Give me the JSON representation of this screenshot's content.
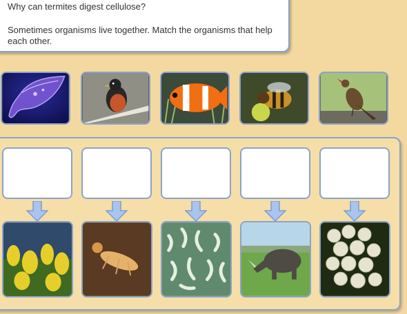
{
  "question": {
    "line1": "Why can termites digest cellulose?",
    "line2": "Sometimes organisms live together. Match the organisms that help each other."
  },
  "cards": [
    {
      "name": "protozoan",
      "icon": "protozoan-image"
    },
    {
      "name": "robin",
      "icon": "robin-image"
    },
    {
      "name": "clownfish",
      "icon": "clownfish-image"
    },
    {
      "name": "bee",
      "icon": "bee-image"
    },
    {
      "name": "oxpecker",
      "icon": "oxpecker-image"
    }
  ],
  "targets": [
    {
      "name": "goldenrod",
      "icon": "goldenrod-image"
    },
    {
      "name": "termite",
      "icon": "termite-image"
    },
    {
      "name": "sea-anemone",
      "icon": "sea-anemone-image"
    },
    {
      "name": "rhinoceros",
      "icon": "rhinoceros-image"
    },
    {
      "name": "eggs",
      "icon": "eggs-image"
    }
  ],
  "colors": {
    "background": "#f3d9a0",
    "border": "#8aa3c8",
    "arrow": "#a9c4ee"
  }
}
